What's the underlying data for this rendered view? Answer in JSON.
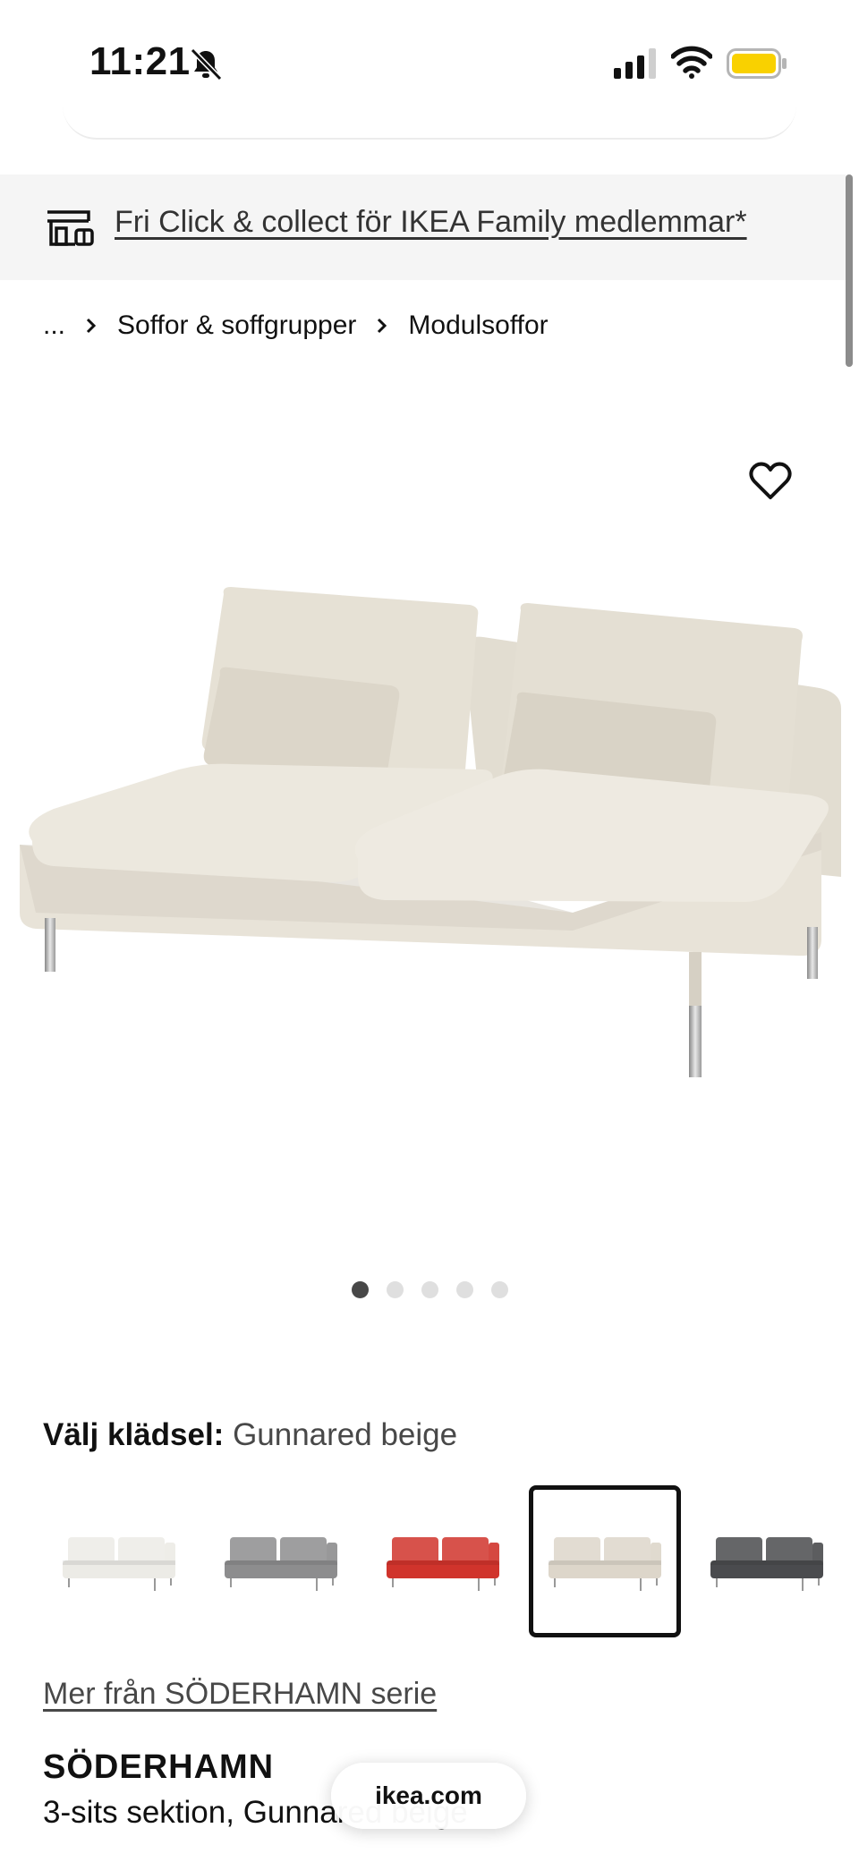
{
  "status_bar": {
    "time": "11:21",
    "battery_color": "#f9d100"
  },
  "promo": {
    "text": "Fri Click & collect för IKEA Family medlemmar*"
  },
  "breadcrumb": {
    "ellipsis": "...",
    "items": [
      "Soffor & soffgrupper",
      "Modulsoffor"
    ]
  },
  "carousel": {
    "total": 5,
    "active_index": 0
  },
  "fabric": {
    "label": "Välj klädsel:",
    "selected": "Gunnared beige",
    "swatches": [
      {
        "color": "#ecebe6"
      },
      {
        "color": "#8d8d8e"
      },
      {
        "color": "#d0342c"
      },
      {
        "color": "#ddd6ca"
      },
      {
        "color": "#4a4b4e"
      }
    ],
    "selected_index": 3
  },
  "series_link": "Mer från SÖDERHAMN serie",
  "product": {
    "name": "SÖDERHAMN",
    "description": "3-sits sektion, Gunnared beige"
  },
  "browser": {
    "url": "ikea.com"
  }
}
